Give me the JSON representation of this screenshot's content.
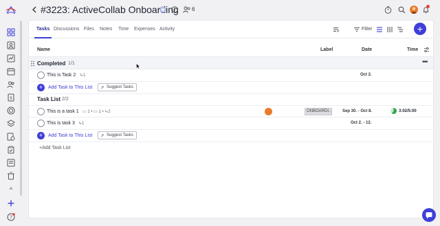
{
  "header": {
    "title": "#3223: ActiveCollab Onboarding",
    "people_count": "6"
  },
  "tabs": [
    {
      "label": "Tasks",
      "active": true
    },
    {
      "label": "Discussions"
    },
    {
      "label": "Files"
    },
    {
      "label": "Notes"
    },
    {
      "label": "Time"
    },
    {
      "label": "Expenses"
    },
    {
      "label": "Activity"
    }
  ],
  "toolbar": {
    "filter_label": "Filter",
    "add_symbol": "+"
  },
  "columns": {
    "name": "Name",
    "label": "Label",
    "date": "Date",
    "time": "Time"
  },
  "completed": {
    "title": "Completed",
    "count": "1/1",
    "more": "•••",
    "tasks": [
      {
        "name": "This is Task 2",
        "subtasks": "1",
        "date": "Oct 2."
      }
    ],
    "add_task": "Add Task to This List",
    "suggest": "Suggest Tasks"
  },
  "task_list": {
    "title": "Task List",
    "count": "2/2",
    "tasks": [
      {
        "name": "This is a task 1",
        "files": "1",
        "comments": "1",
        "subtasks": "2",
        "label": "ONBOARDI...",
        "date": "Sep 30. - Oct 8.",
        "time": "3:02/5:00",
        "time_progress": 0.604
      },
      {
        "name": "This is task 3",
        "subtasks": "1",
        "date": "Oct 2. - 12."
      }
    ],
    "add_task": "Add Task to This List",
    "suggest": "Suggest Tasks"
  },
  "add_task_list": "+Add Task List",
  "colors": {
    "accent": "#3e3fd8",
    "background": "#f1f1f4",
    "avatar": "#e87b2c",
    "time_progress": "#2ea44f"
  },
  "icons": {
    "rail": [
      "projects-icon",
      "profile-icon",
      "reports-icon",
      "calendar-icon",
      "people-icon",
      "invoices-icon",
      "target-icon",
      "layers-icon",
      "timesheet-icon",
      "clipboard-icon",
      "documents-icon",
      "trash-icon",
      "add-icon",
      "help-icon"
    ]
  }
}
